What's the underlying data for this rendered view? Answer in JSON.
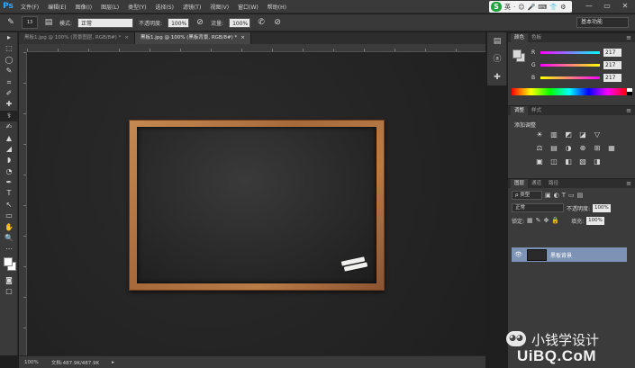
{
  "app": {
    "logo": "Ps"
  },
  "menu": [
    "文件(F)",
    "编辑(E)",
    "图像(I)",
    "图层(L)",
    "类型(Y)",
    "选择(S)",
    "滤镜(T)",
    "视图(V)",
    "窗口(W)",
    "帮助(H)"
  ],
  "ime": {
    "logo": "S",
    "mode": "英",
    "icons": [
      "·",
      "☺",
      "🎤",
      "⌨",
      "👕",
      "⚙"
    ]
  },
  "window_controls": [
    "—",
    "▭",
    "✕"
  ],
  "options_bar": {
    "brush_size": "13",
    "mode_label": "模式:",
    "mode_value": "正常",
    "opacity_label": "不透明度:",
    "opacity_value": "100%",
    "flow_label": "流量:",
    "flow_value": "100%"
  },
  "workspace": "基本功能",
  "tabs": [
    {
      "label": "黑板1.jpg @ 100% (背景图层, RGB/8#) *",
      "active": false
    },
    {
      "label": "黑板1.jpg @ 100% (黑板背景, RGB/8#) *",
      "active": true
    }
  ],
  "tools": [
    "▸",
    "⬚",
    "◯",
    "✎",
    "⌗",
    "✐",
    "✚",
    "⚕",
    "✍",
    "▲",
    "◢",
    "◗",
    "◔",
    "✒",
    "T",
    "↖",
    "▭",
    "✋",
    "🔍",
    "⋯"
  ],
  "status": {
    "zoom": "100%",
    "doc": "文档:487.9K/487.9K"
  },
  "color_panel": {
    "tabs": [
      "颜色",
      "色板"
    ],
    "channels": [
      {
        "label": "R",
        "value": "217",
        "gradient": [
          "#ff00ff",
          "#00ffff"
        ]
      },
      {
        "label": "G",
        "value": "217",
        "gradient": [
          "#ff00ff",
          "#ffff00"
        ]
      },
      {
        "label": "B",
        "value": "217",
        "gradient": [
          "#ffff00",
          "#ff00ff"
        ]
      }
    ]
  },
  "adjust_panel": {
    "tabs": [
      "调整",
      "样式"
    ],
    "title": "添加调整",
    "icons": [
      "☀",
      "▥",
      "◩",
      "◪",
      "▽",
      "",
      "⚖",
      "▤",
      "◑",
      "⊕",
      "⊞",
      "▦",
      "▣",
      "◫",
      "◧",
      "▧",
      "◨",
      ""
    ]
  },
  "layers_panel": {
    "tabs": [
      "图层",
      "通道",
      "路径"
    ],
    "kind_label": "ρ 类型",
    "blend_mode": "正常",
    "opacity_label": "不透明度:",
    "opacity_value": "100%",
    "lock_label": "锁定:",
    "fill_label": "填充:",
    "fill_value": "100%",
    "layers": [
      {
        "name": "黑板背景",
        "visible": true,
        "selected": true
      }
    ]
  },
  "watermark": {
    "name": "小钱学设计",
    "url": "UiBQ.CoM"
  },
  "colors": {
    "accent": "#31a8ff",
    "layer_selected": "#7d93b5",
    "frame_wood": "#b97c47",
    "board": "#2a2a2a"
  }
}
